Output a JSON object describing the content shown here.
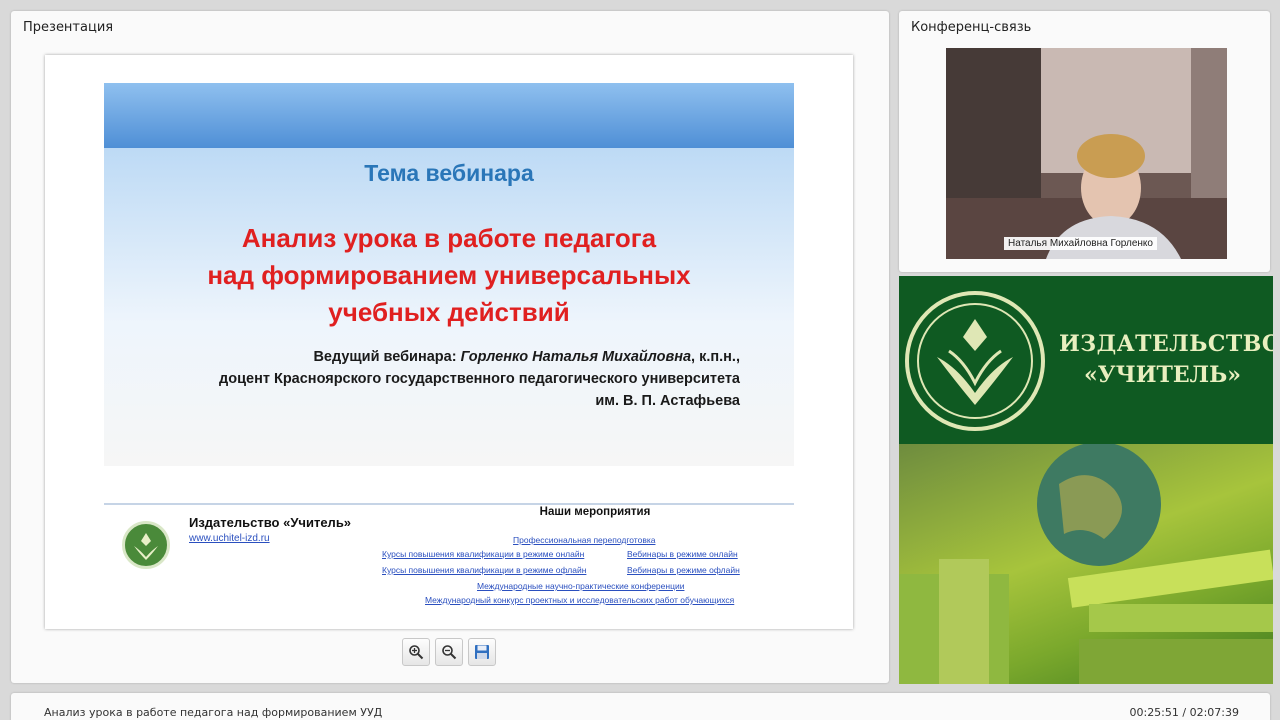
{
  "presentation": {
    "panel_title": "Презентация",
    "slide": {
      "topic_label": "Тема вебинара",
      "title_lines": [
        "Анализ урока в работе педагога",
        "над формированием универсальных",
        "учебных действий"
      ],
      "lead_label": "Ведущий вебинара:",
      "lead_name": "Горленко Наталья Михайловна",
      "lead_degree": ", к.п.н.,",
      "lead_line2": "доцент Красноярского государственного педагогического университета",
      "lead_line3": "им. В. П. Астафьева",
      "publisher": "Издательство «Учитель»",
      "publisher_url": "www.uchitel-izd.ru",
      "events_title": "Наши мероприятия",
      "events": [
        "Профессиональная переподготовка",
        "Курсы повышения квалификации в режиме онлайн",
        "Вебинары в режиме онлайн",
        "Курсы повышения квалификации в режиме офлайн",
        "Вебинары в режиме офлайн",
        "Международные научно-практические конференции",
        "Международный конкурс проектных и исследовательских работ обучающихся"
      ]
    },
    "toolbar": {
      "zoom_in": "zoom-in-icon",
      "zoom_out": "zoom-out-icon",
      "save": "save-icon"
    }
  },
  "conference": {
    "panel_title": "Конференц-связь",
    "participant_name": "Наталья Михайловна Горленко"
  },
  "banner": {
    "line1": "ИЗДАТЕЛЬСТВО",
    "line2": "«УЧИТЕЛЬ»"
  },
  "bottom_bar": {
    "lesson_title": "Анализ урока в работе педагога над формированием УУД",
    "time": "00:25:51 / 02:07:39"
  },
  "colors": {
    "topic_blue": "#2a76b8",
    "title_red": "#e02020",
    "banner_green": "#0f5a22",
    "link_blue": "#2a4fbf"
  }
}
